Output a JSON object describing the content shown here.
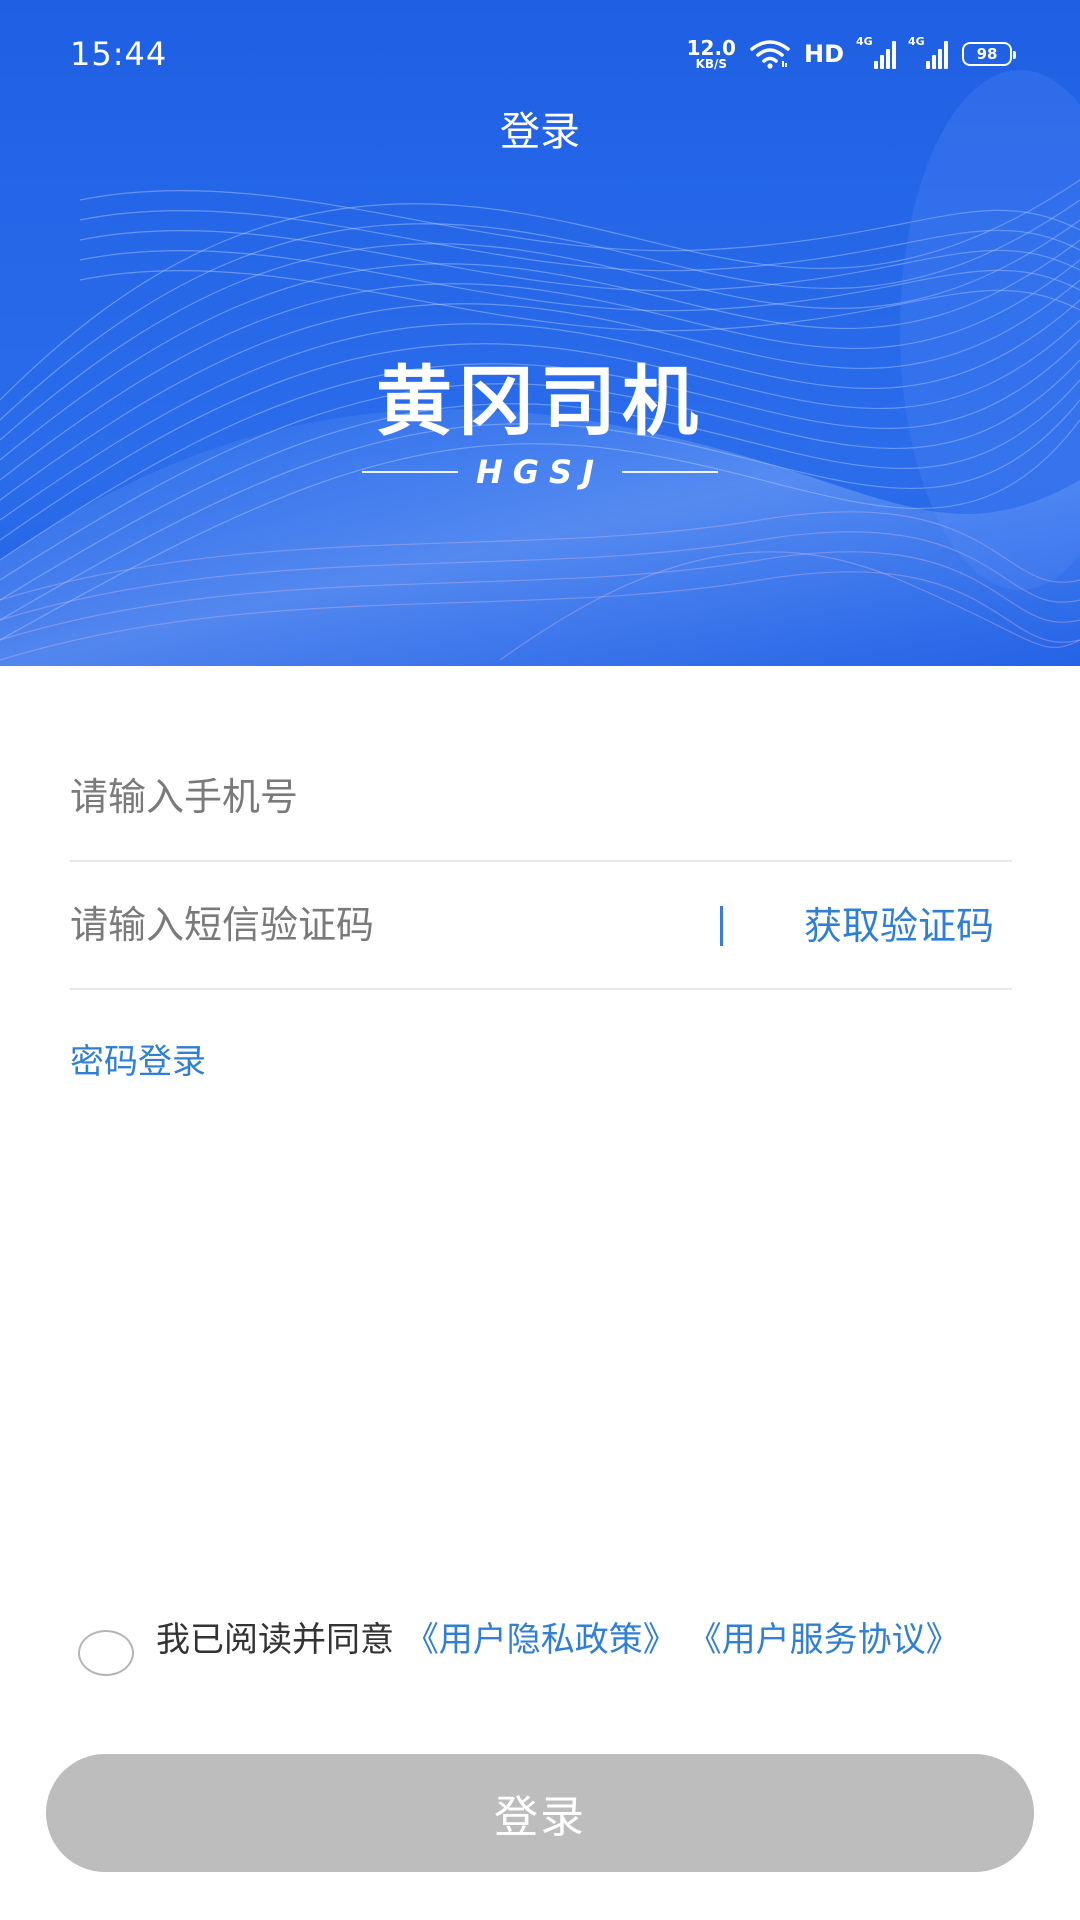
{
  "status_bar": {
    "time": "15:44",
    "net_speed_value": "12.0",
    "net_speed_unit": "KB/S",
    "hd_label": "HD",
    "signal_1_label": "4G",
    "signal_2_label": "4G",
    "battery_level": "98"
  },
  "header": {
    "title": "登录"
  },
  "banner": {
    "brand_name": "黄冈司机",
    "brand_subtitle": "HGSJ"
  },
  "form": {
    "phone_placeholder": "请输入手机号",
    "code_placeholder": "请输入短信验证码",
    "get_code_label": "获取验证码",
    "password_login_label": "密码登录"
  },
  "agreement": {
    "prefix": "我已阅读并同意",
    "privacy_link": "《用户隐私政策》",
    "service_link": "《用户服务协议》"
  },
  "login_button": {
    "label": "登录"
  },
  "colors": {
    "primary_blue": "#2566e8",
    "link_blue": "#2f7fd4",
    "button_disabled": "#bdbdbd"
  }
}
